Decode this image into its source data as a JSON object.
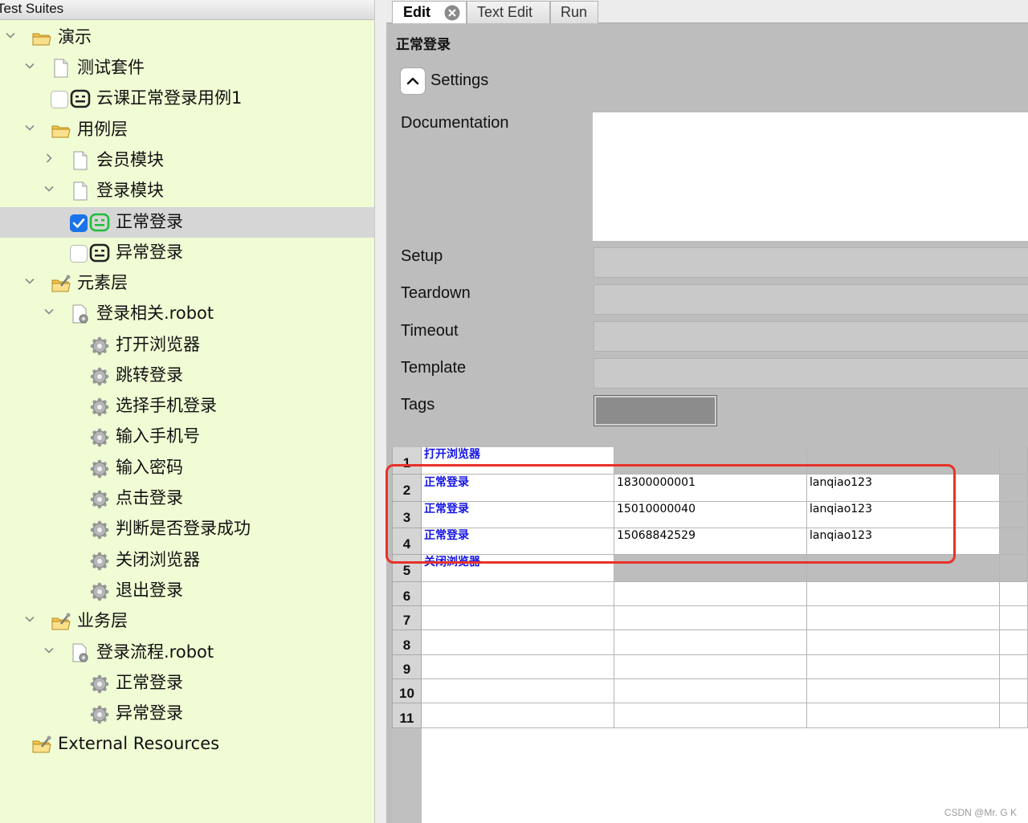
{
  "tree": {
    "header": "Test Suites",
    "items": [
      {
        "label": "演示",
        "icon": "folder-open-icon",
        "expanded": true
      },
      {
        "label": "测试套件",
        "icon": "file-icon",
        "expanded": true
      },
      {
        "label": "云课正常登录用例1",
        "icon": "robot-icon",
        "checked": false
      },
      {
        "label": "用例层",
        "icon": "folder-open-icon",
        "expanded": true
      },
      {
        "label": "会员模块",
        "icon": "file-icon",
        "expanded": false
      },
      {
        "label": "登录模块",
        "icon": "file-icon",
        "expanded": true
      },
      {
        "label": "正常登录",
        "icon": "robot-icon",
        "checked": true,
        "selected": true
      },
      {
        "label": "异常登录",
        "icon": "robot-icon",
        "checked": false
      },
      {
        "label": "元素层",
        "icon": "resource-folder-icon",
        "expanded": true
      },
      {
        "label": "登录相关.robot",
        "icon": "resource-file-icon",
        "expanded": true
      },
      {
        "label": "打开浏览器",
        "icon": "keyword-gear-icon"
      },
      {
        "label": "跳转登录",
        "icon": "keyword-gear-icon"
      },
      {
        "label": "选择手机登录",
        "icon": "keyword-gear-icon"
      },
      {
        "label": "输入手机号",
        "icon": "keyword-gear-icon"
      },
      {
        "label": "输入密码",
        "icon": "keyword-gear-icon"
      },
      {
        "label": "点击登录",
        "icon": "keyword-gear-icon"
      },
      {
        "label": "判断是否登录成功",
        "icon": "keyword-gear-icon"
      },
      {
        "label": "关闭浏览器",
        "icon": "keyword-gear-icon"
      },
      {
        "label": "退出登录",
        "icon": "keyword-gear-icon"
      },
      {
        "label": "业务层",
        "icon": "resource-folder-icon",
        "expanded": true
      },
      {
        "label": "登录流程.robot",
        "icon": "resource-file-icon",
        "expanded": true
      },
      {
        "label": "正常登录",
        "icon": "keyword-gear-icon"
      },
      {
        "label": "异常登录",
        "icon": "keyword-gear-icon"
      },
      {
        "label": "External Resources",
        "icon": "resource-folder-icon"
      }
    ]
  },
  "tabs": [
    {
      "label": "Edit",
      "active": true,
      "closable": true
    },
    {
      "label": "Text Edit",
      "active": false
    },
    {
      "label": "Run",
      "active": false
    }
  ],
  "editor": {
    "title": "正常登录",
    "settings_label": "Settings",
    "fields": {
      "documentation": "Documentation",
      "setup": "Setup",
      "teardown": "Teardown",
      "timeout": "Timeout",
      "template": "Template",
      "tags": "Tags"
    }
  },
  "grid": {
    "rows": [
      {
        "num": "1",
        "cells": [
          "打开浏览器",
          "",
          ""
        ]
      },
      {
        "num": "2",
        "cells": [
          "正常登录",
          "18300000001",
          "lanqiao123"
        ]
      },
      {
        "num": "3",
        "cells": [
          "正常登录",
          "15010000040",
          "lanqiao123"
        ]
      },
      {
        "num": "4",
        "cells": [
          "正常登录",
          "15068842529",
          "lanqiao123"
        ]
      },
      {
        "num": "5",
        "cells": [
          "关闭浏览器",
          "",
          ""
        ]
      },
      {
        "num": "6",
        "cells": [
          "",
          "",
          ""
        ]
      },
      {
        "num": "7",
        "cells": [
          "",
          "",
          ""
        ]
      },
      {
        "num": "8",
        "cells": [
          "",
          "",
          ""
        ]
      },
      {
        "num": "9",
        "cells": [
          "",
          "",
          ""
        ]
      },
      {
        "num": "10",
        "cells": [
          "",
          "",
          ""
        ]
      },
      {
        "num": "11",
        "cells": [
          "",
          "",
          ""
        ]
      }
    ]
  },
  "annotation": {
    "color": "#e8312a"
  },
  "watermark": "CSDN @Mr. G K"
}
